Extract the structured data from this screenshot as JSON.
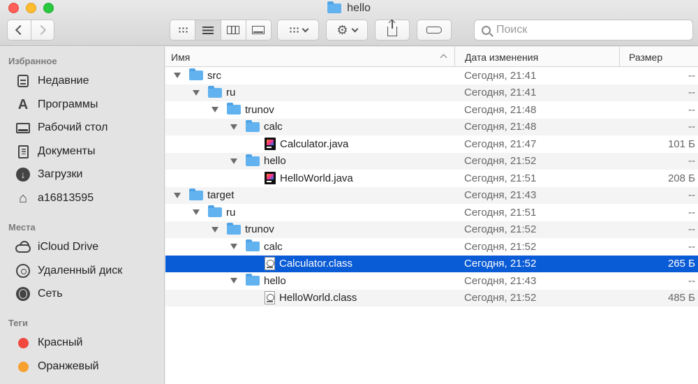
{
  "window": {
    "title": "hello"
  },
  "toolbar": {
    "views": [
      "icon-view",
      "list-view",
      "column-view",
      "gallery-view"
    ],
    "active_view": "list-view",
    "search_placeholder": "Поиск"
  },
  "sidebar": {
    "favorites_title": "Избранное",
    "favorites": [
      {
        "label": "Недавние",
        "icon": "recents-icon"
      },
      {
        "label": "Программы",
        "icon": "applications-icon"
      },
      {
        "label": "Рабочий стол",
        "icon": "desktop-icon"
      },
      {
        "label": "Документы",
        "icon": "documents-icon"
      },
      {
        "label": "Загрузки",
        "icon": "downloads-icon"
      },
      {
        "label": "a16813595",
        "icon": "home-icon"
      }
    ],
    "locations_title": "Места",
    "locations": [
      {
        "label": "iCloud Drive",
        "icon": "icloud-icon"
      },
      {
        "label": "Удаленный диск",
        "icon": "remote-disc-icon"
      },
      {
        "label": "Сеть",
        "icon": "network-icon"
      }
    ],
    "tags_title": "Теги",
    "tags": [
      {
        "label": "Красный",
        "color": "#f0483f"
      },
      {
        "label": "Оранжевый",
        "color": "#f6a030"
      }
    ]
  },
  "list": {
    "columns": {
      "name": "Имя",
      "date": "Дата изменения",
      "size": "Размер"
    },
    "rows": [
      {
        "name": "src",
        "date": "Сегодня, 21:41",
        "size": "--",
        "depth": 0,
        "kind": "folder"
      },
      {
        "name": "ru",
        "date": "Сегодня, 21:41",
        "size": "--",
        "depth": 1,
        "kind": "folder"
      },
      {
        "name": "trunov",
        "date": "Сегодня, 21:48",
        "size": "--",
        "depth": 2,
        "kind": "folder"
      },
      {
        "name": "calc",
        "date": "Сегодня, 21:48",
        "size": "--",
        "depth": 3,
        "kind": "folder"
      },
      {
        "name": "Calculator.java",
        "date": "Сегодня, 21:47",
        "size": "101 Б",
        "depth": 4,
        "kind": "java"
      },
      {
        "name": "hello",
        "date": "Сегодня, 21:52",
        "size": "--",
        "depth": 3,
        "kind": "folder"
      },
      {
        "name": "HelloWorld.java",
        "date": "Сегодня, 21:51",
        "size": "208 Б",
        "depth": 4,
        "kind": "java"
      },
      {
        "name": "target",
        "date": "Сегодня, 21:43",
        "size": "--",
        "depth": 0,
        "kind": "folder"
      },
      {
        "name": "ru",
        "date": "Сегодня, 21:51",
        "size": "--",
        "depth": 1,
        "kind": "folder"
      },
      {
        "name": "trunov",
        "date": "Сегодня, 21:52",
        "size": "--",
        "depth": 2,
        "kind": "folder"
      },
      {
        "name": "calc",
        "date": "Сегодня, 21:52",
        "size": "--",
        "depth": 3,
        "kind": "folder"
      },
      {
        "name": "Calculator.class",
        "date": "Сегодня, 21:52",
        "size": "265 Б",
        "depth": 4,
        "kind": "class",
        "selected": true
      },
      {
        "name": "hello",
        "date": "Сегодня, 21:43",
        "size": "--",
        "depth": 3,
        "kind": "folder"
      },
      {
        "name": "HelloWorld.class",
        "date": "Сегодня, 21:52",
        "size": "485 Б",
        "depth": 4,
        "kind": "class"
      }
    ]
  }
}
